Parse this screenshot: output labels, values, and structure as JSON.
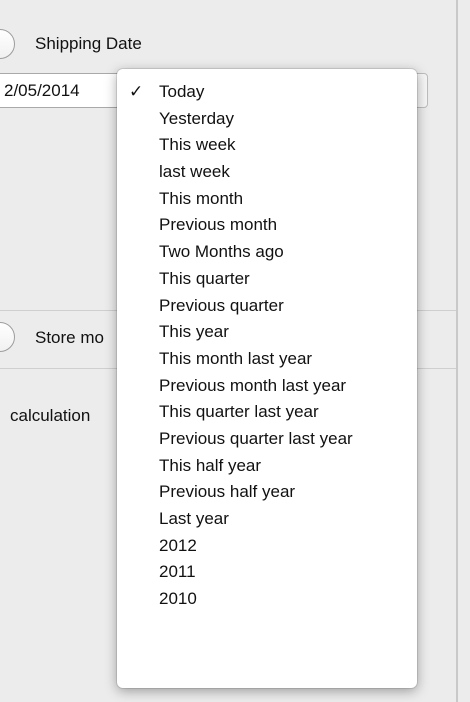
{
  "shipping": {
    "label": "Shipping Date",
    "date_value": "2/05/2014"
  },
  "store": {
    "label": "Store mo",
    "calculation_label": "calculation"
  },
  "menu": {
    "selected_index": 0,
    "check_glyph": "✓",
    "items": [
      "Today",
      "Yesterday",
      "This week",
      "last week",
      "This month",
      "Previous month",
      "Two Months ago",
      "This quarter",
      "Previous quarter",
      "This year",
      "This month last year",
      "Previous month last year",
      "This quarter last year",
      "Previous quarter last year",
      "This half year",
      "Previous half year",
      "Last year",
      "2012",
      "2011",
      "2010"
    ]
  }
}
